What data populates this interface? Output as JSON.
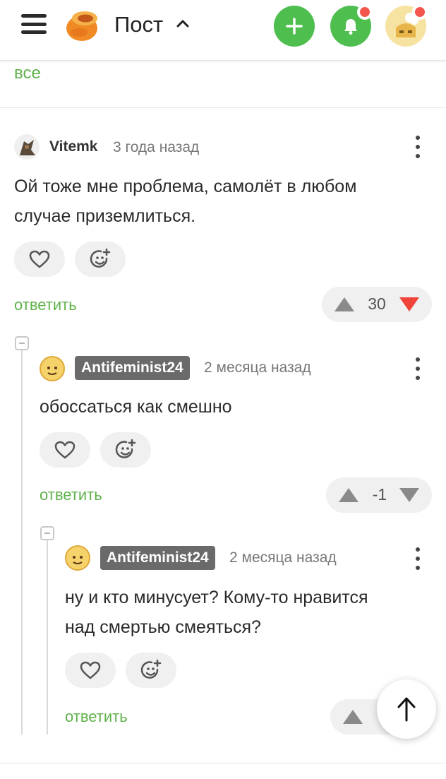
{
  "header": {
    "title": "Пост",
    "accent_color": "#4ebe4e",
    "notification_color": "#f4564e"
  },
  "all_link": "все",
  "comments": [
    {
      "username": "Vitemk",
      "time": "3 года назад",
      "text_lines": [
        "Ой тоже мне проблема, самолёт в любом",
        "случае приземлиться."
      ],
      "reply_label": "ответить",
      "rating": "30"
    },
    {
      "username": "Antifeminist24",
      "time": "2 месяца назад",
      "text_lines": [
        "обоссаться как смешно"
      ],
      "reply_label": "ответить",
      "rating": "-1"
    },
    {
      "username": "Antifeminist24",
      "time": "2 месяца назад",
      "text_lines": [
        "ну и кто минусует? Кому-то нравится",
        "над смертью смеяться?"
      ],
      "reply_label": "ответить",
      "rating": ""
    }
  ],
  "icons": [
    "menu-icon",
    "logo-icon",
    "chevron-up-icon",
    "plus-icon",
    "bell-icon",
    "user-avatar",
    "heart-icon",
    "emoji-add-icon",
    "arrow-up-icon",
    "arrow-down-icon",
    "more-icon",
    "scroll-top-icon"
  ]
}
